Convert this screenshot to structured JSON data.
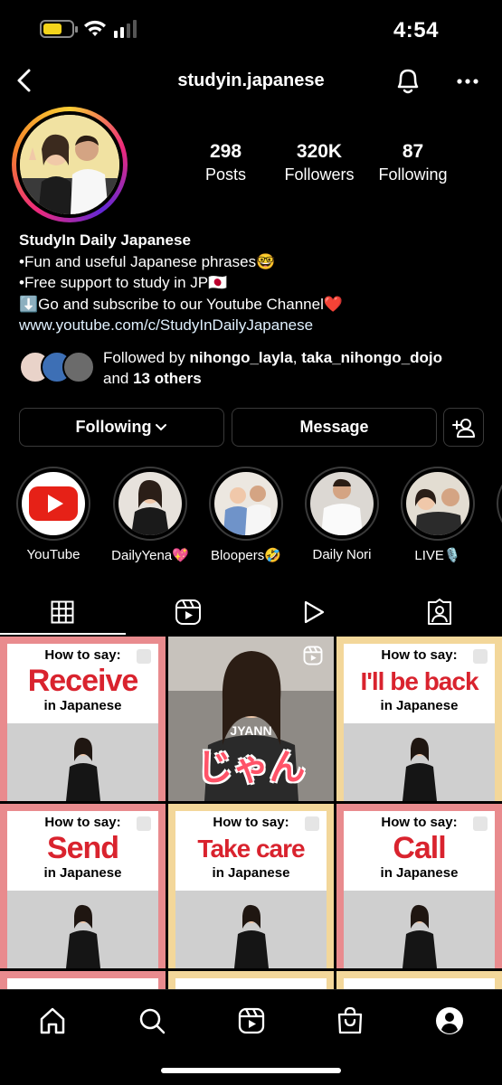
{
  "status_bar": {
    "time": "4:54"
  },
  "header": {
    "username": "studyin.japanese"
  },
  "stats": [
    {
      "value": "298",
      "label": "Posts"
    },
    {
      "value": "320K",
      "label": "Followers"
    },
    {
      "value": "87",
      "label": "Following"
    }
  ],
  "bio": {
    "name": "StudyIn Daily Japanese",
    "line1": "•Fun and useful Japanese phrases🤓",
    "line2": "•Free support to study in JP🇯🇵",
    "line3": "⬇️Go and subscribe to our Youtube Channel❤️",
    "link": "www.youtube.com/c/StudyInDailyJapanese"
  },
  "followed_by": {
    "prefix": "Followed by ",
    "user1": "nihongo_layla",
    "sep": ", ",
    "user2": "taka_nihongo_dojo",
    "and": "and ",
    "others": "13 others"
  },
  "buttons": {
    "following": "Following",
    "message": "Message"
  },
  "highlights": [
    {
      "label": "YouTube"
    },
    {
      "label": "DailyYena💖"
    },
    {
      "label": "Bloopers🤣"
    },
    {
      "label": "Daily Nori"
    },
    {
      "label": "LIVE🎙️"
    }
  ],
  "grid": {
    "how_to_say": "How to say:",
    "in_japanese": "in Japanese",
    "posts": [
      {
        "word": "Receive"
      },
      {
        "romaji": "JYANN",
        "kana": "じゃん"
      },
      {
        "word": "I'll be back"
      },
      {
        "word": "Send"
      },
      {
        "word": "Take care"
      },
      {
        "word": "Call"
      }
    ]
  },
  "colors": {
    "background": "#000000",
    "accent_red": "#d9232e",
    "tile_pink": "#e98b8e",
    "tile_yellow": "#f3d79a",
    "border": "#3a3a3a"
  }
}
